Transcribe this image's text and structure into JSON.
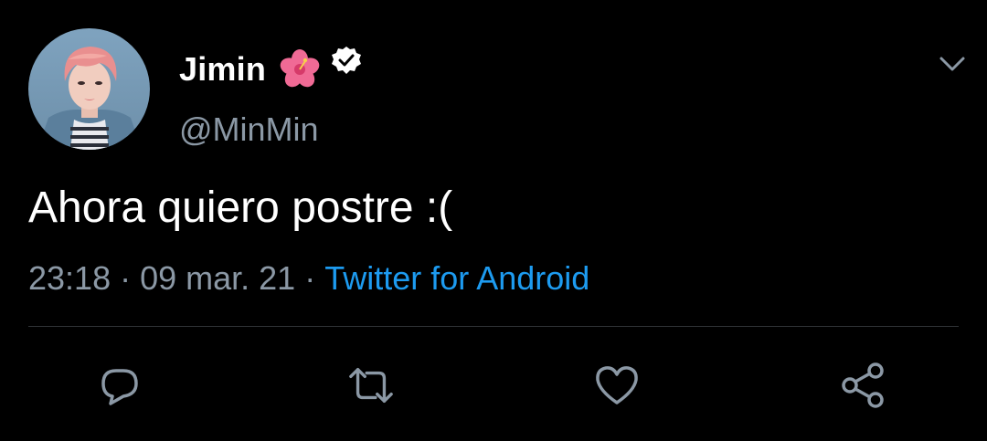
{
  "tweet": {
    "display_name": "Jimin",
    "name_emoji": "🌺",
    "verified_icon": "verified-badge-icon",
    "handle": "@MinMin",
    "text": "Ahora quiero postre :(",
    "time": "23:18",
    "separator": "·",
    "date": "09 mar. 21",
    "source": "Twitter for Android"
  },
  "actions": {
    "reply_icon": "reply-icon",
    "retweet_icon": "retweet-icon",
    "like_icon": "heart-icon",
    "share_icon": "share-icon",
    "more_icon": "chevron-down-icon"
  },
  "colors": {
    "background": "#000000",
    "text": "#ffffff",
    "secondary_text": "#8b98a5",
    "link": "#1d9bf0",
    "divider": "#2f3336"
  }
}
